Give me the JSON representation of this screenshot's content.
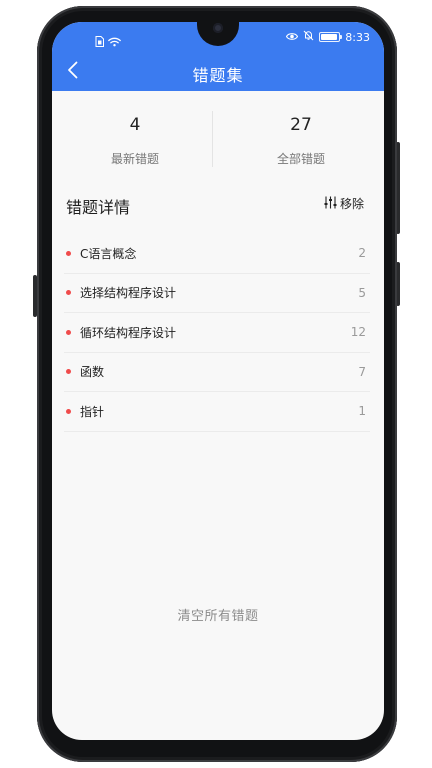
{
  "status_bar": {
    "time": "8:33",
    "icons_left": [
      "sim-icon",
      "wifi-icon"
    ],
    "icons_right": [
      "eye-icon",
      "mute-icon",
      "battery-icon"
    ],
    "battery_level": 0.9
  },
  "header": {
    "title": "错题集",
    "back_icon": "chevron-left-icon"
  },
  "stats": {
    "latest": {
      "value": "4",
      "label": "最新错题"
    },
    "all": {
      "value": "27",
      "label": "全部错题"
    }
  },
  "details": {
    "title": "错题详情",
    "remove_label": "移除",
    "remove_icon": "sliders-icon"
  },
  "items": [
    {
      "label": "C语言概念",
      "count": "2"
    },
    {
      "label": "选择结构程序设计",
      "count": "5"
    },
    {
      "label": "循环结构程序设计",
      "count": "12"
    },
    {
      "label": "函数",
      "count": "7"
    },
    {
      "label": "指针",
      "count": "1"
    }
  ],
  "clear_label": "清空所有错题",
  "colors": {
    "accent": "#3b7bf0",
    "dot": "#f04b4b"
  }
}
